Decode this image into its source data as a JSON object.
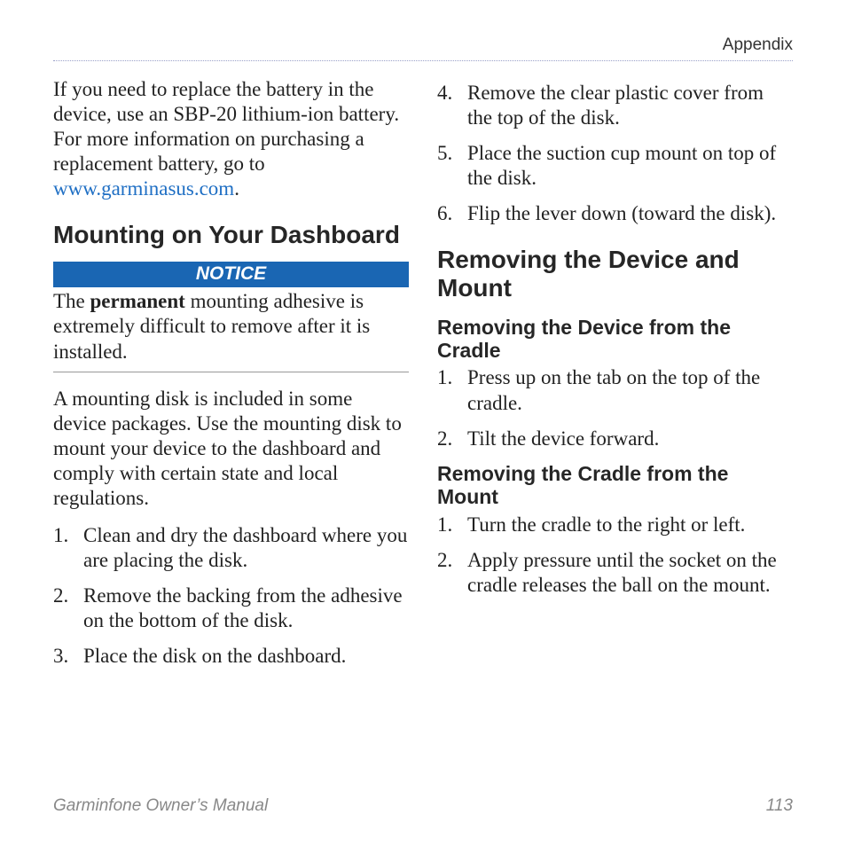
{
  "header": {
    "section": "Appendix"
  },
  "left": {
    "intro": {
      "pre": "If you need to replace the battery in the device, use an SBP-20 lithium-ion battery. For more information on purchasing a replacement battery, go to ",
      "link": "www.garminasus.com",
      "post": "."
    },
    "h2": "Mounting on Your Dashboard",
    "notice": {
      "label": "NOTICE",
      "text_pre": "The ",
      "text_bold": "permanent",
      "text_post": " mounting adhesive is extremely difficult to remove after it is installed."
    },
    "disk_para": "A mounting disk is included in some device packages. Use the mounting disk to mount your device to the dashboard and comply with certain state and local regulations.",
    "steps": [
      "Clean and dry the dashboard where you are placing the disk.",
      "Remove the backing from the adhesive on the bottom of the disk.",
      "Place the disk on the dashboard."
    ]
  },
  "right": {
    "steps_cont": [
      "Remove the clear plastic cover from the top of the disk.",
      "Place the suction cup mount on top of the disk.",
      "Flip the lever down (toward the disk)."
    ],
    "h2": "Removing the Device and Mount",
    "h3a": "Removing the Device from the Cradle",
    "steps_a": [
      "Press up on the tab on the top of the cradle.",
      "Tilt the device forward."
    ],
    "h3b": "Removing the Cradle from the Mount",
    "steps_b": [
      "Turn the cradle to the right or left.",
      "Apply pressure until the socket on the cradle releases the ball on the mount."
    ]
  },
  "footer": {
    "title": "Garminfone Owner’s Manual",
    "page": "113"
  }
}
